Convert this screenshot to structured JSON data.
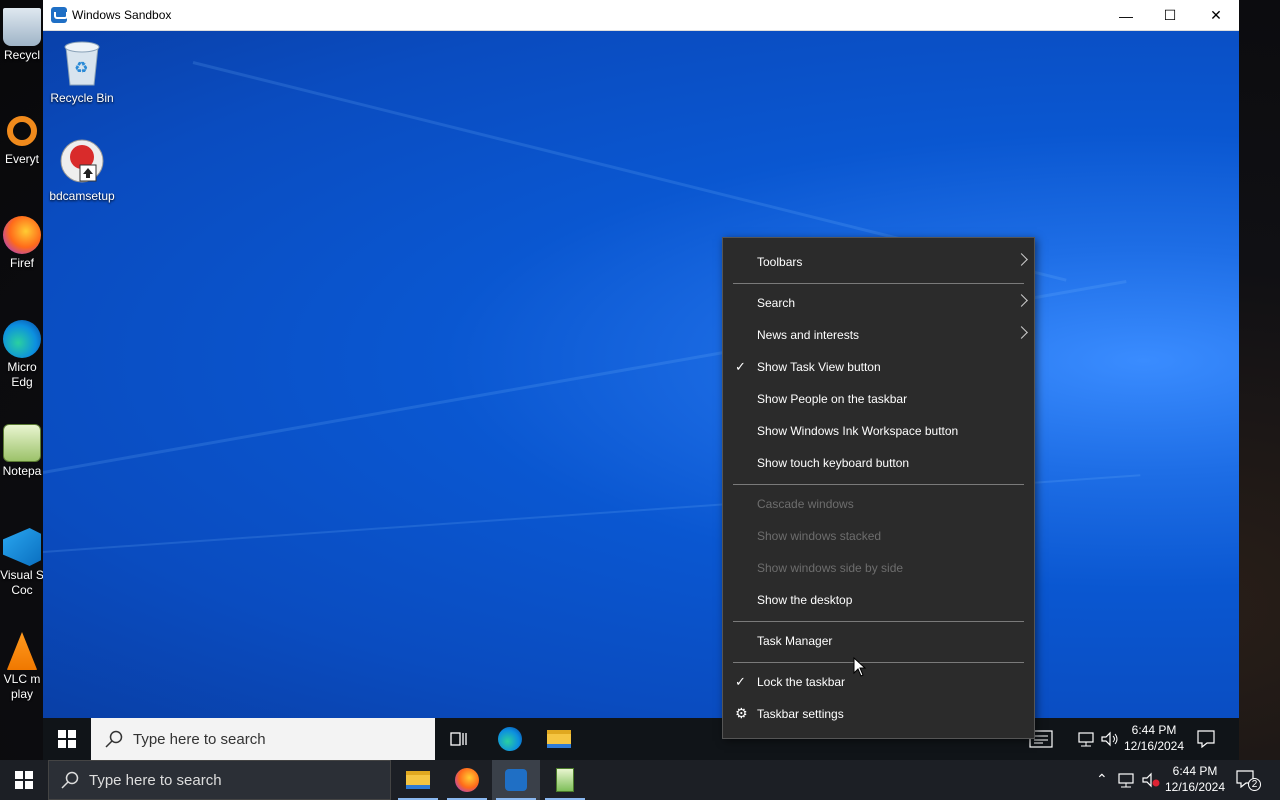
{
  "host_desktop": {
    "icons": [
      {
        "label": "Recycl",
        "icon": "recycle-bin-icon"
      },
      {
        "label": "Everyt",
        "icon": "everything-search-icon"
      },
      {
        "label": "Firef",
        "icon": "firefox-icon"
      },
      {
        "label": "Micro Edg",
        "icon": "edge-icon"
      },
      {
        "label": "Notepa",
        "icon": "notepad-icon"
      },
      {
        "label": "Visual S Coc",
        "icon": "vscode-icon"
      },
      {
        "label": "VLC m play",
        "icon": "vlc-icon"
      }
    ]
  },
  "window": {
    "title": "Windows Sandbox",
    "minimize": "—",
    "maximize": "☐",
    "close": "✕"
  },
  "guest_desktop": {
    "icons": [
      {
        "label": "Recycle Bin",
        "icon": "recycle-bin-icon"
      },
      {
        "label": "bdcamsetup",
        "icon": "bandicam-setup-icon"
      }
    ]
  },
  "guest_taskbar": {
    "search_placeholder": "Type here to search",
    "apps": [
      "task-view-icon",
      "edge-icon",
      "file-explorer-icon"
    ],
    "time": "6:44 PM",
    "date": "12/16/2024"
  },
  "context_menu": {
    "items": [
      {
        "label": "Toolbars",
        "submenu": true,
        "checked": false,
        "disabled": false
      },
      {
        "label": "Search",
        "submenu": true,
        "checked": false,
        "disabled": false
      },
      {
        "label": "News and interests",
        "submenu": true,
        "checked": false,
        "disabled": false
      },
      {
        "label": "Show Task View button",
        "submenu": false,
        "checked": true,
        "disabled": false
      },
      {
        "label": "Show People on the taskbar",
        "submenu": false,
        "checked": false,
        "disabled": false
      },
      {
        "label": "Show Windows Ink Workspace button",
        "submenu": false,
        "checked": false,
        "disabled": false
      },
      {
        "label": "Show touch keyboard button",
        "submenu": false,
        "checked": false,
        "disabled": false
      },
      {
        "label": "Cascade windows",
        "submenu": false,
        "checked": false,
        "disabled": true
      },
      {
        "label": "Show windows stacked",
        "submenu": false,
        "checked": false,
        "disabled": true
      },
      {
        "label": "Show windows side by side",
        "submenu": false,
        "checked": false,
        "disabled": true
      },
      {
        "label": "Show the desktop",
        "submenu": false,
        "checked": false,
        "disabled": false
      },
      {
        "label": "Task Manager",
        "submenu": false,
        "checked": false,
        "disabled": false
      },
      {
        "label": "Lock the taskbar",
        "submenu": false,
        "checked": true,
        "disabled": false
      },
      {
        "label": "Taskbar settings",
        "submenu": false,
        "checked": false,
        "disabled": false,
        "icon": "gear-icon"
      }
    ],
    "check_glyph": "✓",
    "gear_glyph": "⚙"
  },
  "host_taskbar": {
    "search_placeholder": "Type here to search",
    "apps": [
      "file-explorer-icon",
      "firefox-icon",
      "windows-sandbox-icon",
      "notepad-plus-icon"
    ],
    "time": "6:44 PM",
    "date": "12/16/2024",
    "notification_count": "2"
  }
}
